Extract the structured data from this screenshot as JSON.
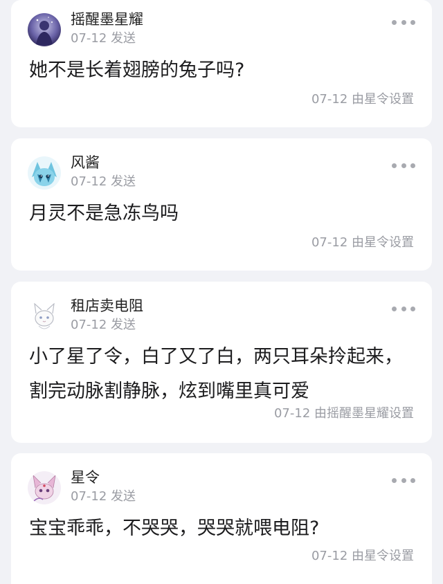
{
  "comments": [
    {
      "author": "摇醒墨星耀",
      "meta": "07-12 发送",
      "text": "她不是长着翅膀的兔子吗?",
      "footer": "07-12 由星令设置",
      "avatar_icon": "avatar-purple-silhouette-icon"
    },
    {
      "author": "风酱",
      "meta": "07-12 发送",
      "text": "月灵不是急冻鸟吗",
      "footer": "07-12 由星令设置",
      "avatar_icon": "avatar-ice-creature-icon"
    },
    {
      "author": "租店卖电阻",
      "meta": "07-12 发送",
      "text": "小了星了令，白了又了白，两只耳朵拎起来，割完动脉割静脉，炫到嘴里真可爱",
      "footer": "07-12 由摇醒墨星耀设置",
      "avatar_icon": "avatar-sketch-creature-icon"
    },
    {
      "author": "星令",
      "meta": "07-12 发送",
      "text": "宝宝乖乖，不哭哭，哭哭就喂电阻?",
      "footer": "07-12 由星令设置",
      "avatar_icon": "avatar-pink-creature-icon"
    }
  ],
  "colors": {
    "background": "#f1f2f6",
    "card": "#ffffff",
    "muted_text": "#9a9ca3"
  }
}
